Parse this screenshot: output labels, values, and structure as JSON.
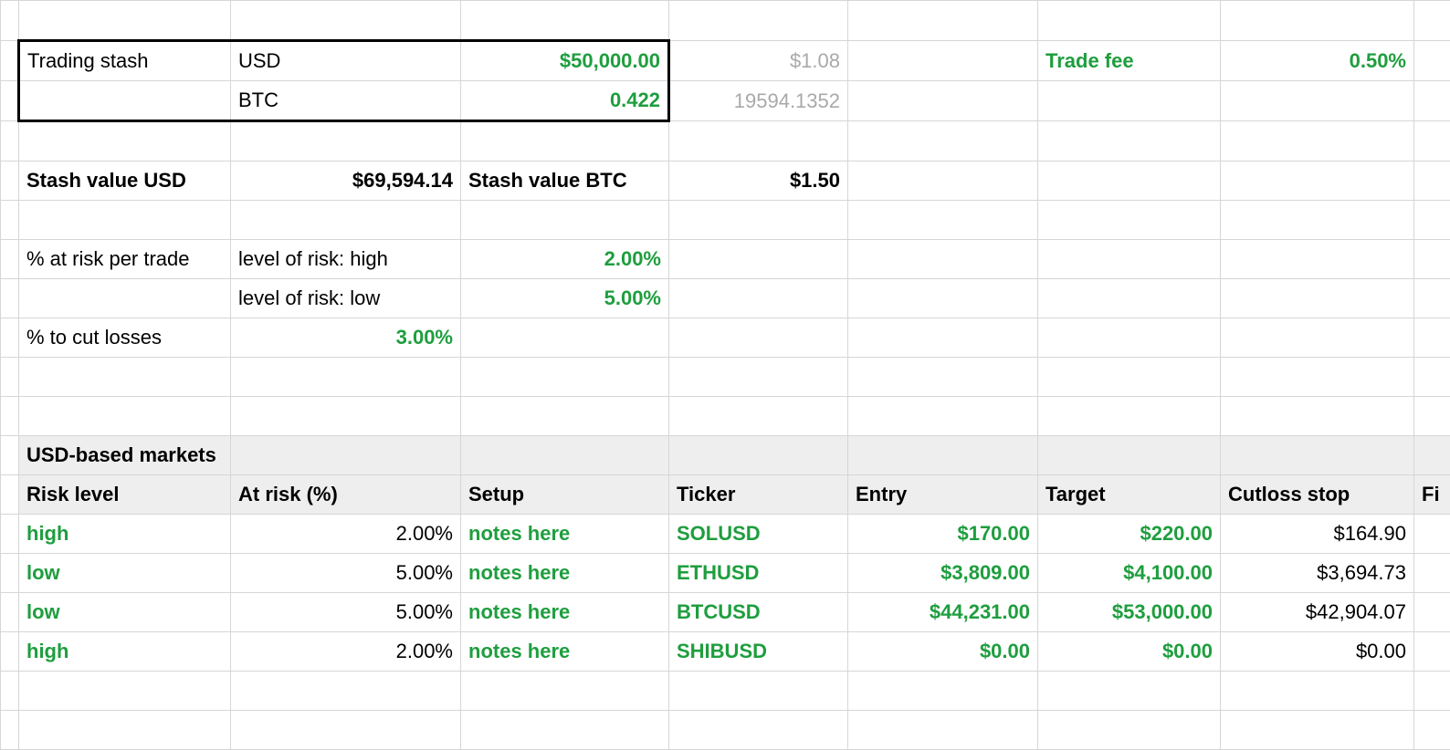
{
  "top": {
    "trading_stash_label": "Trading stash",
    "usd_label": "USD",
    "usd_value": "$50,000.00",
    "usd_side": "$1.08",
    "trade_fee_label": "Trade fee",
    "trade_fee_value": "0.50%",
    "btc_label": "BTC",
    "btc_value": "0.422",
    "btc_side": "19594.1352",
    "stash_value_usd_label": "Stash value USD",
    "stash_value_usd": "$69,594.14",
    "stash_value_btc_label": "Stash value BTC",
    "stash_value_btc": "$1.50",
    "pct_risk_label": "% at risk per trade",
    "risk_high_label": "level of risk: high",
    "risk_high_value": "2.00%",
    "risk_low_label": "level of risk: low",
    "risk_low_value": "5.00%",
    "cut_losses_label": "% to cut losses",
    "cut_losses_value": "3.00%"
  },
  "headers": {
    "section": "USD-based markets",
    "risk": "Risk level",
    "atrisk": "At risk (%)",
    "setup": "Setup",
    "ticker": "Ticker",
    "entry": "Entry",
    "target": "Target",
    "cutloss": "Cutloss stop",
    "fi": "Fi"
  },
  "rows": [
    {
      "risk": "high",
      "atrisk": "2.00%",
      "setup": "notes here",
      "ticker": "SOLUSD",
      "entry": "$170.00",
      "target": "$220.00",
      "cutloss": "$164.90"
    },
    {
      "risk": "low",
      "atrisk": "5.00%",
      "setup": "notes here",
      "ticker": "ETHUSD",
      "entry": "$3,809.00",
      "target": "$4,100.00",
      "cutloss": "$3,694.73"
    },
    {
      "risk": "low",
      "atrisk": "5.00%",
      "setup": "notes here",
      "ticker": "BTCUSD",
      "entry": "$44,231.00",
      "target": "$53,000.00",
      "cutloss": "$42,904.07"
    },
    {
      "risk": "high",
      "atrisk": "2.00%",
      "setup": "notes here",
      "ticker": "SHIBUSD",
      "entry": "$0.00",
      "target": "$0.00",
      "cutloss": "$0.00"
    }
  ]
}
